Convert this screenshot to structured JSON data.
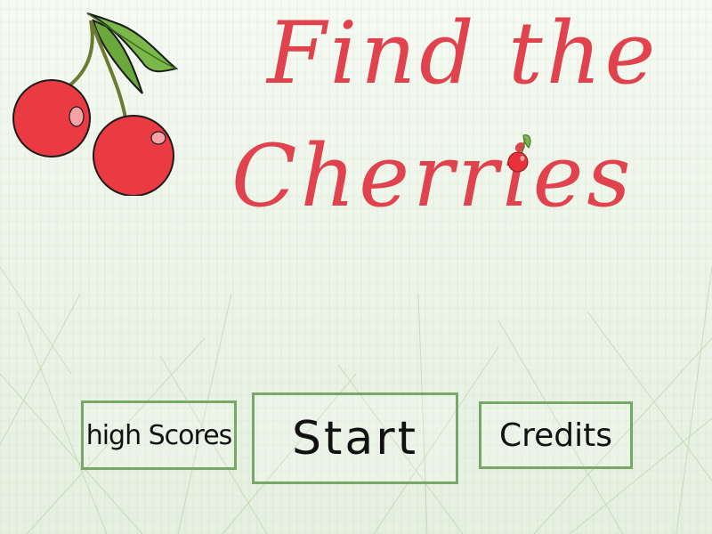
{
  "title": {
    "line1": "Find the",
    "line2": "Cherries"
  },
  "menu": {
    "high_scores_label": "high Scores",
    "start_label": "Start",
    "credits_label": "Credits"
  },
  "colors": {
    "title_red": "#e0434d",
    "cherry_red": "#ea3b43",
    "leaf_green": "#7ab84a",
    "button_border": "#78a868"
  }
}
